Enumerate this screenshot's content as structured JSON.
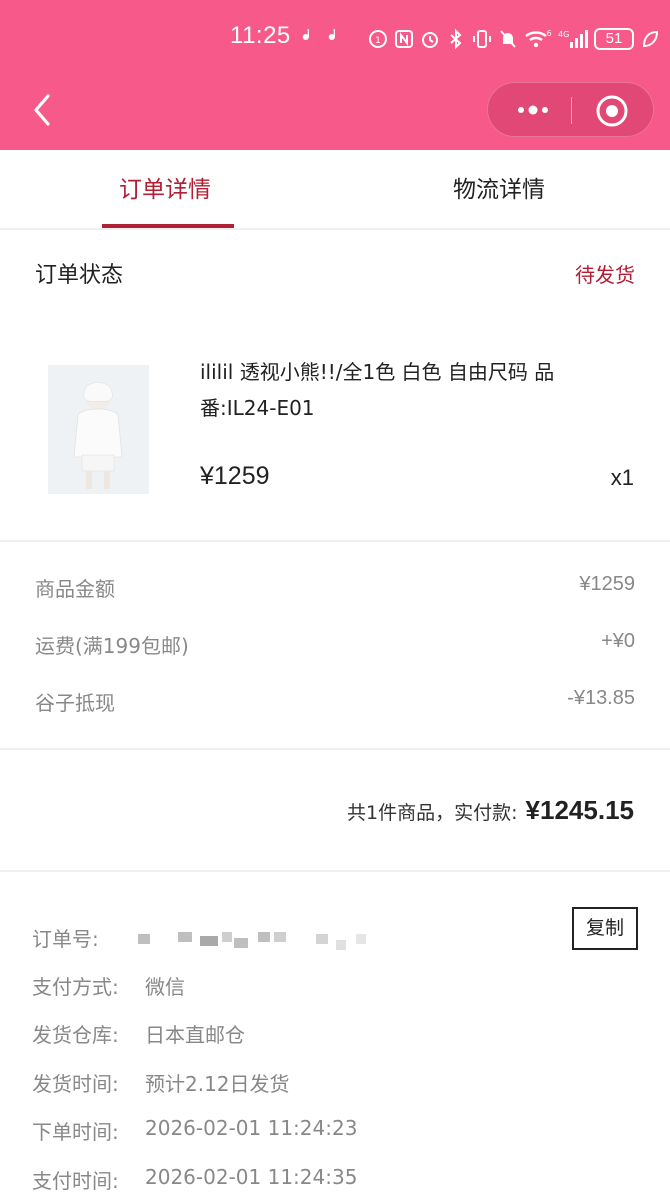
{
  "status_bar": {
    "time": "11:25",
    "battery": "51",
    "icons": [
      "bilibili-icon",
      "bilibili-icon",
      "app-icon",
      "nfc-icon",
      "alarm-icon",
      "bluetooth-icon",
      "vibrate-icon",
      "mute-icon",
      "wifi-icon",
      "signal-icon",
      "leaf-icon"
    ],
    "network": "4G",
    "wifi_badge": "6"
  },
  "nav": {
    "back_icon": "chevron-left-icon",
    "more_icon": "more-dots-icon",
    "close_icon": "target-icon"
  },
  "tabs": [
    {
      "label": "订单详情",
      "active": true
    },
    {
      "label": "物流详情",
      "active": false
    }
  ],
  "order_status": {
    "title": "订单状态",
    "value": "待发货"
  },
  "product": {
    "title": "ililil 透视小熊!!/全1色 白色 自由尺码 品番:IL24-E01",
    "price": "¥1259",
    "quantity": "x1"
  },
  "fees": [
    {
      "label": "商品金额",
      "value": "¥1259"
    },
    {
      "label": "运费(满199包邮)",
      "value": "+¥0"
    },
    {
      "label": "谷子抵现",
      "value": "-¥13.85"
    }
  ],
  "summary": {
    "label": "共1件商品，实付款:",
    "total": "¥1245.15"
  },
  "order_info": {
    "copy_button": "复制",
    "rows": [
      {
        "label": "订单号:",
        "value": ""
      },
      {
        "label": "支付方式:",
        "value": "微信"
      },
      {
        "label": "发货仓库:",
        "value": "日本直邮仓"
      },
      {
        "label": "发货时间:",
        "value": "预计2.12日发货"
      },
      {
        "label": "下单时间:",
        "value": "2026-02-01 11:24:23"
      },
      {
        "label": "支付时间:",
        "value": "2026-02-01 11:24:35"
      }
    ]
  },
  "colors": {
    "header_pink": "#f6598a",
    "accent_red": "#b01f35",
    "muted_text": "#888888"
  }
}
